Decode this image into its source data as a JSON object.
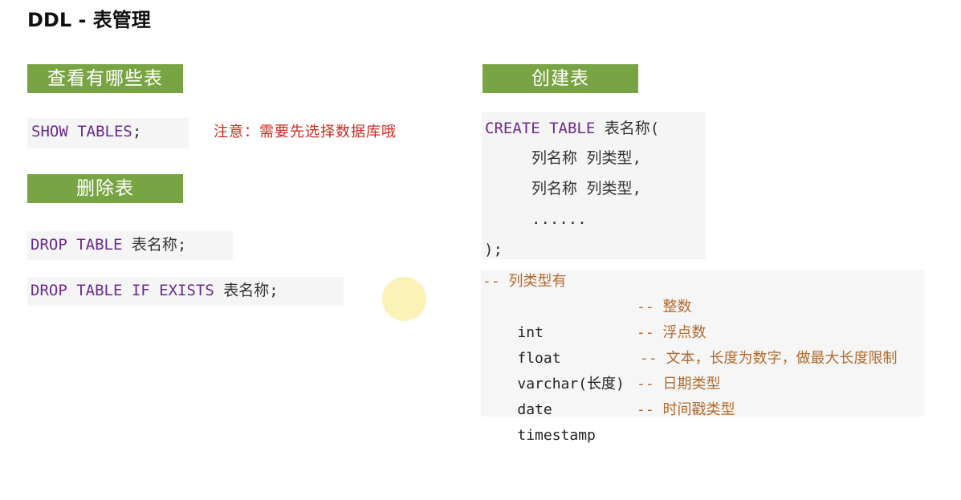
{
  "title": "DDL - 表管理",
  "left": {
    "show_header": "查看有哪些表",
    "show_sql": {
      "kw": "SHOW TABLES",
      "rest": ";"
    },
    "note": "注意：需要先选择数据库哦",
    "drop_header": "删除表",
    "drop_sql_1": {
      "kw": "DROP TABLE",
      "rest": " 表名称;"
    },
    "drop_sql_2": {
      "kw": "DROP TABLE IF EXISTS",
      "rest": " 表名称;"
    }
  },
  "right": {
    "create_header": "创建表",
    "create_sql": {
      "kw": "CREATE TABLE",
      "rest": " 表名称(",
      "col1": "列名称 列类型,",
      "col2": "列名称 列类型,",
      "ellipsis": "......",
      "close": ");"
    },
    "types_header": "-- 列类型有",
    "types": [
      {
        "type": "int",
        "comment": "-- 整数"
      },
      {
        "type": "float",
        "comment": "-- 浮点数"
      },
      {
        "type": "varchar(长度)",
        "comment": "-- 文本，长度为数字，做最大长度限制"
      },
      {
        "type": "date",
        "comment": "-- 日期类型"
      },
      {
        "type": "timestamp",
        "comment": "-- 时间戳类型"
      }
    ]
  }
}
